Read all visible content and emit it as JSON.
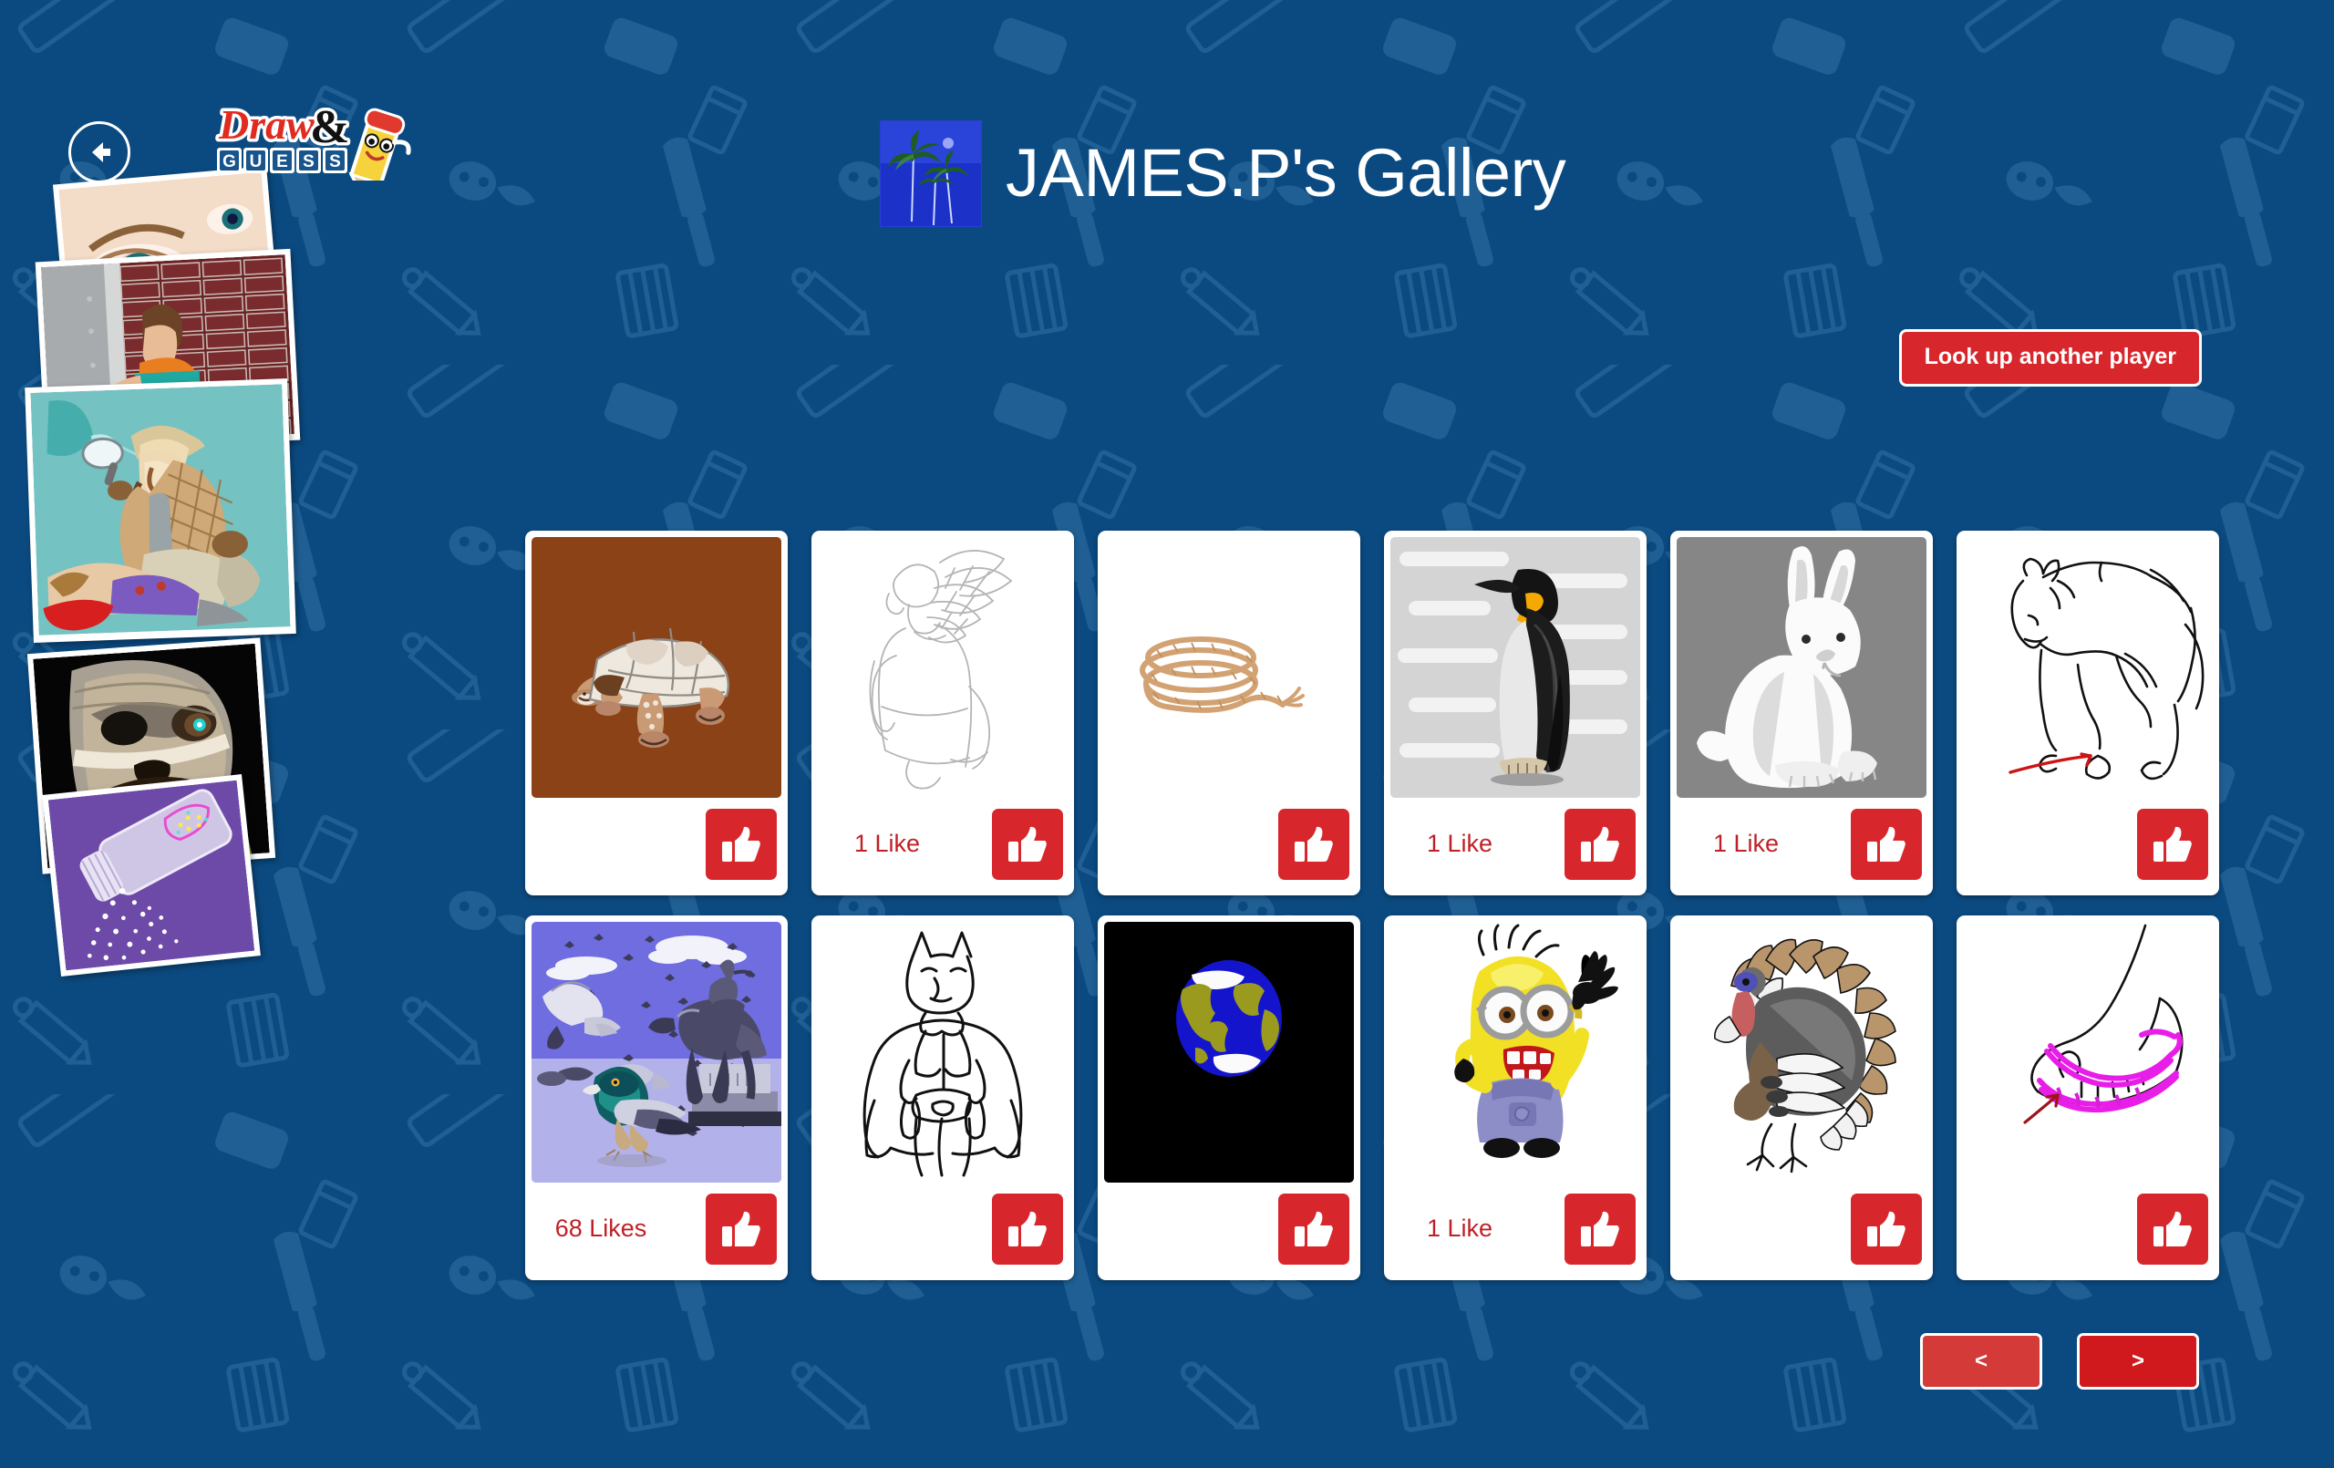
{
  "app": {
    "brand_name": "Draw&",
    "brand_sub": "GUESS",
    "background_color": "#0b4a80",
    "accent_red": "#d8272c",
    "like_text_color": "#bf2026"
  },
  "header": {
    "back_icon": "back-arrow-icon",
    "avatar_alt": "palm-trees-avatar",
    "title": "JAMES.P's Gallery",
    "lookup_label": "Look up another player"
  },
  "art_stack": [
    {
      "name": "crying-eye",
      "caption": "crying eye close-up"
    },
    {
      "name": "man-knocking-door",
      "caption": "man knocking on door at brick wall"
    },
    {
      "name": "detective-crime-scene",
      "caption": "detective with magnifier over body"
    },
    {
      "name": "mummy-face",
      "caption": "screaming mummy face"
    },
    {
      "name": "baby-powder",
      "caption": "spilled powder bottle"
    }
  ],
  "gallery": {
    "like_icon": "thumbs-up-icon",
    "cards": [
      {
        "name": "tortoise",
        "likes_label": "",
        "bg": "#8a4216"
      },
      {
        "name": "angel",
        "likes_label": "1 Like",
        "bg": "#ffffff"
      },
      {
        "name": "rope",
        "likes_label": "",
        "bg": "#ffffff"
      },
      {
        "name": "penguin",
        "likes_label": "1 Like",
        "bg": "#d4d4d4"
      },
      {
        "name": "rabbit",
        "likes_label": "1 Like",
        "bg": "#868686"
      },
      {
        "name": "horse",
        "likes_label": "",
        "bg": "#ffffff"
      },
      {
        "name": "pigeons",
        "likes_label": "68 Likes",
        "bg": "#6f6de0"
      },
      {
        "name": "batman",
        "likes_label": "",
        "bg": "#ffffff"
      },
      {
        "name": "earth",
        "likes_label": "",
        "bg": "#000000"
      },
      {
        "name": "minion",
        "likes_label": "1 Like",
        "bg": "#ffffff"
      },
      {
        "name": "turkey",
        "likes_label": "",
        "bg": "#ffffff"
      },
      {
        "name": "flip-flop",
        "likes_label": "",
        "bg": "#ffffff"
      }
    ]
  },
  "pager": {
    "prev_label": "<",
    "next_label": ">"
  }
}
